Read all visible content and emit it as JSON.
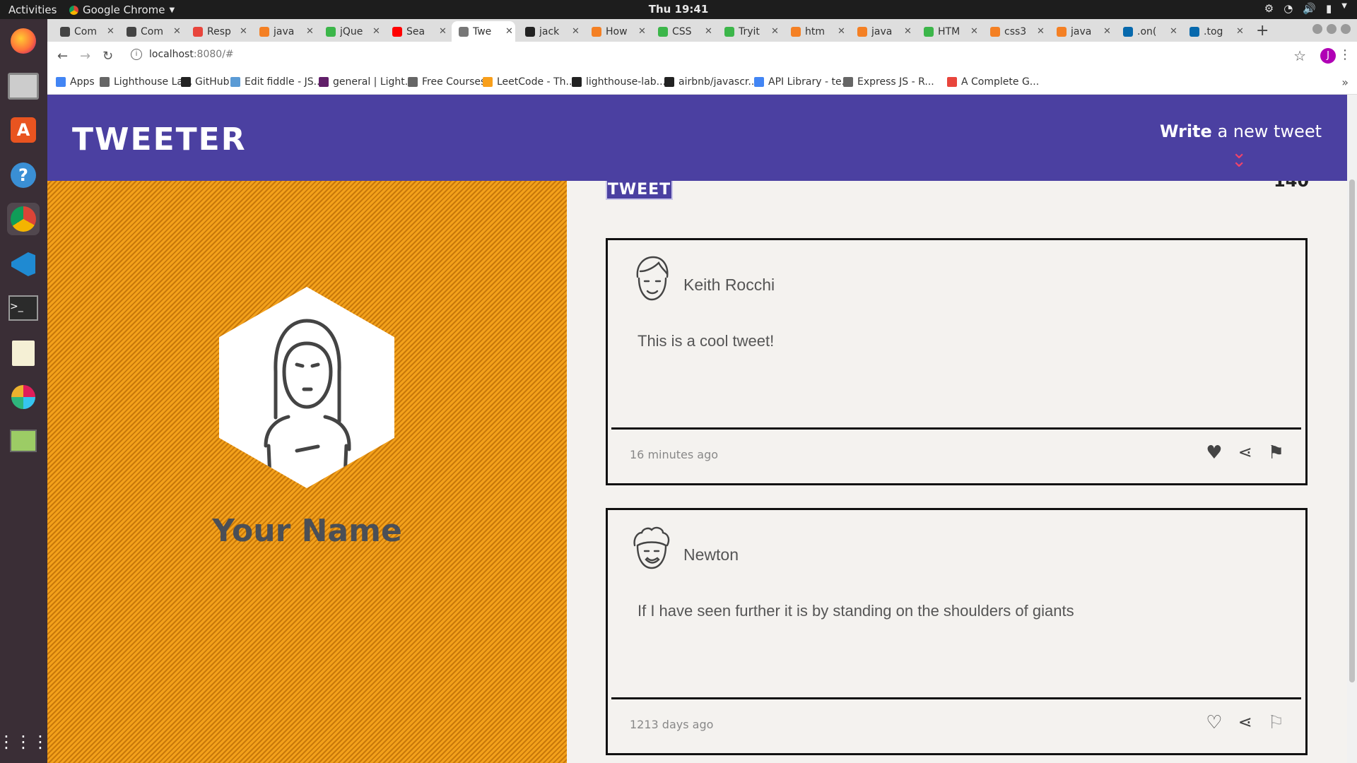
{
  "os": {
    "activities": "Activities",
    "app_name": "Google Chrome",
    "clock": "Thu 19:41"
  },
  "dock": [
    "firefox-icon",
    "files-icon",
    "software-center-icon",
    "help-icon",
    "chrome-icon",
    "vscode-icon",
    "terminal-icon",
    "text-editor-icon",
    "slack-icon",
    "image-viewer-icon",
    "apps-grid-icon"
  ],
  "browser": {
    "tabs": [
      {
        "title": "Com",
        "color": "#444"
      },
      {
        "title": "Com",
        "color": "#444"
      },
      {
        "title": "Resp",
        "color": "#e8453c"
      },
      {
        "title": "java",
        "color": "#f48024"
      },
      {
        "title": "jQue",
        "color": "#3cb64a"
      },
      {
        "title": "Sea",
        "color": "#ff0000"
      },
      {
        "title": "Twe",
        "color": "#777",
        "active": true
      },
      {
        "title": "jack",
        "color": "#222"
      },
      {
        "title": "How",
        "color": "#f48024"
      },
      {
        "title": "CSS",
        "color": "#3cb64a"
      },
      {
        "title": "Tryit",
        "color": "#3cb64a"
      },
      {
        "title": "htm",
        "color": "#f48024"
      },
      {
        "title": "java",
        "color": "#f48024"
      },
      {
        "title": "HTM",
        "color": "#3cb64a"
      },
      {
        "title": "css3",
        "color": "#f48024"
      },
      {
        "title": "java",
        "color": "#f48024"
      },
      {
        "title": ".on(",
        "color": "#0769ad"
      },
      {
        "title": ".tog",
        "color": "#0769ad"
      }
    ],
    "url": {
      "host": "localhost",
      "rest": ":8080/#"
    },
    "profile_initial": "J",
    "bookmarks": [
      {
        "label": "Apps",
        "color": "#4285f4"
      },
      {
        "label": "Lighthouse La...",
        "color": "#666"
      },
      {
        "label": "GitHub",
        "color": "#222"
      },
      {
        "label": "Edit fiddle - JS...",
        "color": "#5b9bd5"
      },
      {
        "label": "general | Light...",
        "color": "#611f69"
      },
      {
        "label": "Free Courses",
        "color": "#666"
      },
      {
        "label": "LeetCode - Th...",
        "color": "#f89f1b"
      },
      {
        "label": "lighthouse-lab...",
        "color": "#222"
      },
      {
        "label": "airbnb/javascr...",
        "color": "#222"
      },
      {
        "label": "API Library - te...",
        "color": "#4285f4"
      },
      {
        "label": "Express JS - R...",
        "color": "#666"
      },
      {
        "label": "A Complete G...",
        "color": "#e8453c"
      }
    ]
  },
  "page": {
    "brand": "TWEETER",
    "compose_bold": "Write",
    "compose_rest": " a new tweet",
    "submit_label": "TWEET",
    "counter": "140",
    "your_name": "Your Name",
    "colors": {
      "nav": "#4b40a1",
      "accent": "#f0436a",
      "pane": "#f3a11b"
    },
    "tweets": [
      {
        "name": "Keith Rocchi",
        "text": "This is a cool tweet!",
        "time": "16 minutes ago"
      },
      {
        "name": "Newton",
        "text": "If I have seen further it is by standing on the shoulders of giants",
        "time": "1213 days ago"
      }
    ]
  }
}
